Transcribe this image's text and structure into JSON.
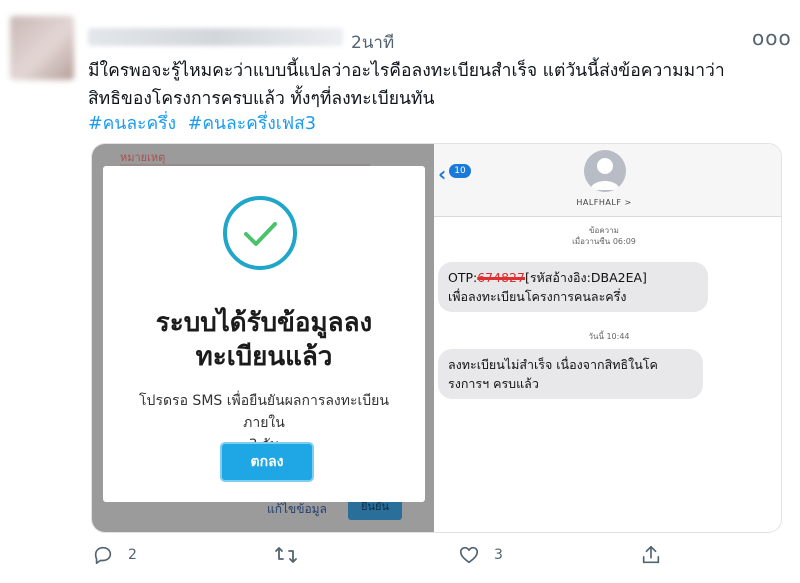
{
  "tweet": {
    "timestamp": "2นาที",
    "more_label": "ooo",
    "text_line1": "มีใครพอจะรู้ไหมคะว่าแบบนี้แปลว่าอะไรคือลงทะเบียนสำเร็จ แต่วันนี้ส่งข้อความมาว่า",
    "text_line2": "สิทธิของโครงการครบแล้ว ทั้งๆที่ลงทะเบียนทัน",
    "hashtags": [
      "#คนละครึ่ง",
      "#คนละครึ่งเฟส3"
    ]
  },
  "media": {
    "left_screen": {
      "background_red_text": "หมายเหตุ",
      "bottom_link": "แก้ไขข้อมูล",
      "bottom_button": "ยืนยัน",
      "dialog": {
        "title_line1": "ระบบได้รับข้อมูลลง",
        "title_line2": "ทะเบียนแล้ว",
        "desc_line1": "โปรดรอ SMS เพื่อยืนยันผลการลงทะเบียน ภายใน",
        "desc_line2": "3 วัน",
        "ok_label": "ตกลง"
      }
    },
    "right_screen": {
      "back_badge": "10",
      "contact_name": "HALFHALF >",
      "timestamp1_line1": "ข้อความ",
      "timestamp1_line2": "เมื่อวานซืน 06:09",
      "message1_prefix": "OTP:",
      "message1_redacted": "674827",
      "message1_suffix": "[รหัสอ้างอิง:DBA2EA]",
      "message1_line2": "เพื่อลงทะเบียนโครงการคนละครึ่ง",
      "timestamp2": "วันนี้ 10:44",
      "message2_line1": "ลงทะเบียนไม่สำเร็จ เนื่องจากสิทธิในโค",
      "message2_line2": "รงการฯ ครบแล้ว"
    }
  },
  "actions": {
    "reply_count": "2",
    "retweet_count": "",
    "like_count": "3"
  },
  "colors": {
    "link_blue": "#1d9bf0",
    "muted_gray": "#536471",
    "dialog_accent": "#1fa6e5",
    "ios_blue": "#1a7ad9"
  }
}
